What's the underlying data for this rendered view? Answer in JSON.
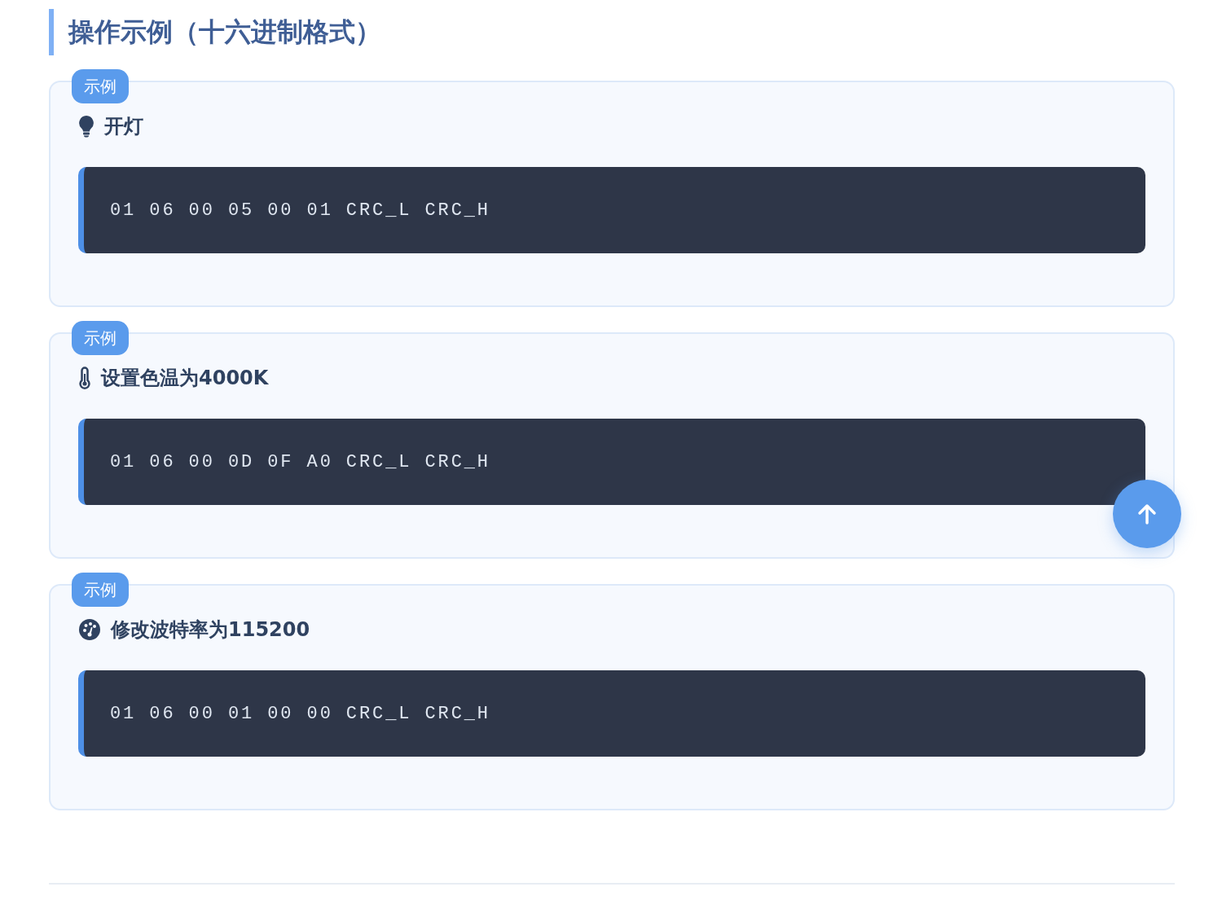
{
  "heading": "操作示例（十六进制格式）",
  "examples": [
    {
      "badge": "示例",
      "kind": "bulb",
      "title": "开灯",
      "code": "01 06 00 05 00 01 CRC_L CRC_H"
    },
    {
      "badge": "示例",
      "kind": "thermometer",
      "title": "设置色温为4000K",
      "code": "01 06 00 0D 0F A0 CRC_L CRC_H"
    },
    {
      "badge": "示例",
      "kind": "gauge",
      "title": "修改波特率为115200",
      "code": "01 06 00 01 00 00 CRC_L CRC_H"
    }
  ],
  "back_to_top": {
    "kind": "arrow-up"
  }
}
